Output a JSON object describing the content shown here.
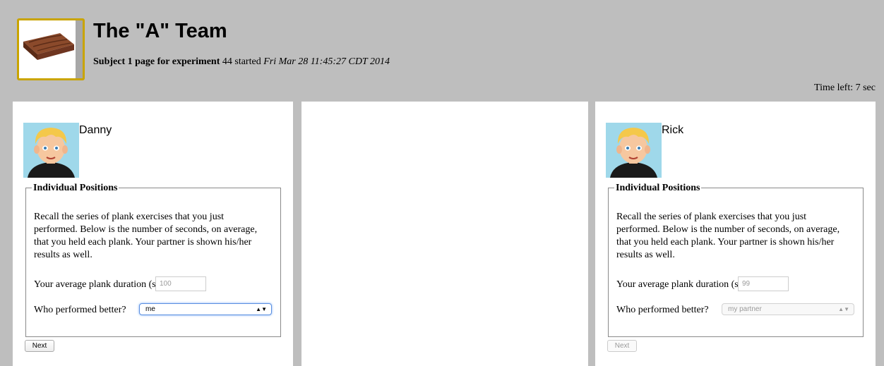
{
  "header": {
    "title": "The \"A\" Team",
    "subtitle_bold": "Subject 1 page for experiment",
    "subtitle_mid": " 44 started ",
    "subtitle_italic": "Fri Mar 28 11:45:27 CDT 2014",
    "time_left": "Time left: 7 sec"
  },
  "left_panel": {
    "name": "Danny",
    "legend": "Individual Positions",
    "recall_text": "Recall the series of plank exercises that you just performed. Below is the number of seconds, on average, that you held each plank. Your partner is shown his/her results as well.",
    "duration_label": "Your average plank duration (sec):",
    "duration_value": "100",
    "better_label": "Who performed better?",
    "better_value": "me",
    "next_label": "Next"
  },
  "right_panel": {
    "name": "Rick",
    "legend": "Individual Positions",
    "recall_text": "Recall the series of plank exercises that you just performed. Below is the number of seconds, on average, that you held each plank. Your partner is shown his/her results as well.",
    "duration_label": "Your average plank duration (sec):",
    "duration_value": "99",
    "better_label": "Who performed better?",
    "better_value": "my partner",
    "next_label": "Next"
  },
  "icons": {
    "logo": "wooden-plank-icon",
    "avatar": "cartoon-boy-avatar",
    "caret": "select-arrows-icon"
  }
}
